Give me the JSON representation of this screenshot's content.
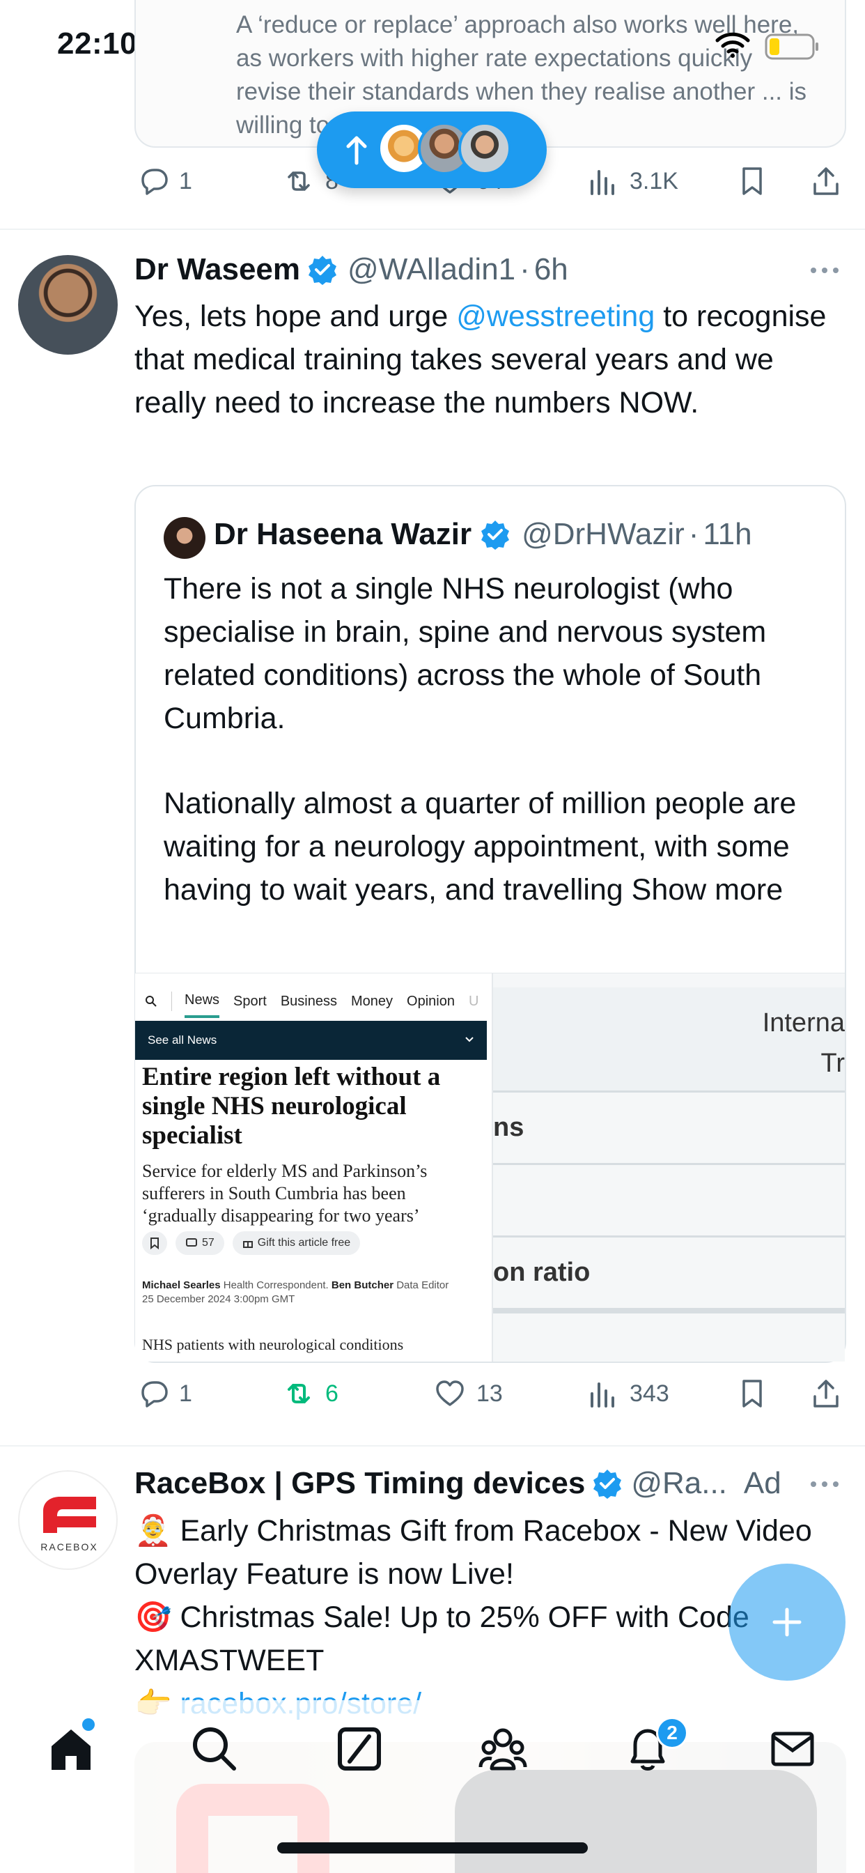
{
  "status_bar": {
    "time": "22:10"
  },
  "top_card": {
    "text": "A ‘reduce or replace’ approach also works well here, as workers with higher rate expectations quickly revise their standards when they realise another ... is willing to work shifts"
  },
  "top_actions": {
    "replies": "1",
    "reposts": "8",
    "likes": "64",
    "views": "3.1K"
  },
  "post": {
    "author": "Dr Waseem",
    "handle": "@WAlladin1",
    "time": "6h",
    "text_before": "Yes, lets hope and urge ",
    "mention": "@wesstreeting",
    "text_after": " to recognise that medical training takes several years and we really need to increase the numbers NOW."
  },
  "quote": {
    "author": "Dr Haseena Wazir",
    "handle": "@DrHWazir",
    "time": "11h",
    "paragraph1": "There is not a single NHS neurologist (who specialise in brain, spine and nervous system related conditions) across the whole of South Cumbria.",
    "paragraph2": "Nationally almost a quarter of million people are waiting for a neurology appointment, with some having to wait years, and travelling",
    "show_more": "Show more"
  },
  "article": {
    "nav": [
      "News",
      "Sport",
      "Business",
      "Money",
      "Opinion",
      "U"
    ],
    "see_all": "See all News",
    "headline": "Entire region left without a single NHS neurological specialist",
    "subhead": "Service for elderly MS and Parkinson’s sufferers in South Cumbria has been ‘gradually disappearing for two years’",
    "comments": "57",
    "gift": "Gift this article free",
    "author1": "Michael Searles",
    "role1": "Health Correspondent.",
    "author2": "Ben Butcher",
    "role2": "Data Editor",
    "date": "25 December 2024 3:00pm GMT",
    "body": "NHS patients with neurological conditions"
  },
  "table_image": {
    "header1": "Interna",
    "header2": "Tr",
    "row1": "ns",
    "row3": "on ratio"
  },
  "post_actions": {
    "replies": "1",
    "reposts": "6",
    "likes": "13",
    "views": "343",
    "repost_color": "#00ba7c"
  },
  "ad": {
    "author": "RaceBox | GPS Timing devices",
    "handle": "@Ra...",
    "label": "Ad",
    "logo_text": "RACEBOX",
    "line1": "🤶 Early Christmas Gift from Racebox - New Video Overlay Feature is now Live!",
    "line2": "🎯 Christmas Sale! Up to 25% OFF with Code XMASTWEET",
    "link_prefix": "👉 ",
    "link": "racebox.pro/store/"
  },
  "nav": {
    "notifications_badge": "2"
  },
  "colors": {
    "accent": "#1d9bf0",
    "text": "#0f1419",
    "muted": "#536471"
  }
}
